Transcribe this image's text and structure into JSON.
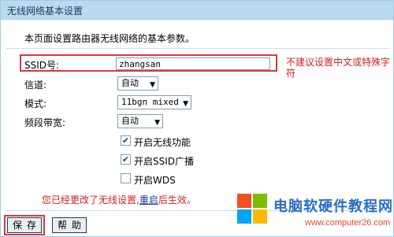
{
  "title": "无线网络基本设置",
  "intro": "本页面设置路由器无线网络的基本参数。",
  "ssid": {
    "label": "SSID号:",
    "value": "zhangsan"
  },
  "hint": "不建议设置中文或特殊字符",
  "channel": {
    "label": "信道:",
    "value": "自动"
  },
  "mode": {
    "label": "模式:",
    "value": "11bgn mixed"
  },
  "bandwidth": {
    "label": "频段带宽:",
    "value": "自动"
  },
  "checkboxes": [
    {
      "label": "开启无线功能",
      "checked": true
    },
    {
      "label": "开启SSID广播",
      "checked": true
    },
    {
      "label": "开启WDS",
      "checked": false
    }
  ],
  "message": {
    "prefix": "您已经更改了无线设置,",
    "link": "重启",
    "suffix": "后生效。"
  },
  "buttons": {
    "save": "保存",
    "help": "帮助"
  },
  "watermark": {
    "title": "电脑软硬件教程网",
    "url": "www.computer26.com"
  },
  "colors": {
    "accent_red": "#d32020",
    "title_bar": "#bcd9ee",
    "link_blue": "#1a3f8f"
  }
}
